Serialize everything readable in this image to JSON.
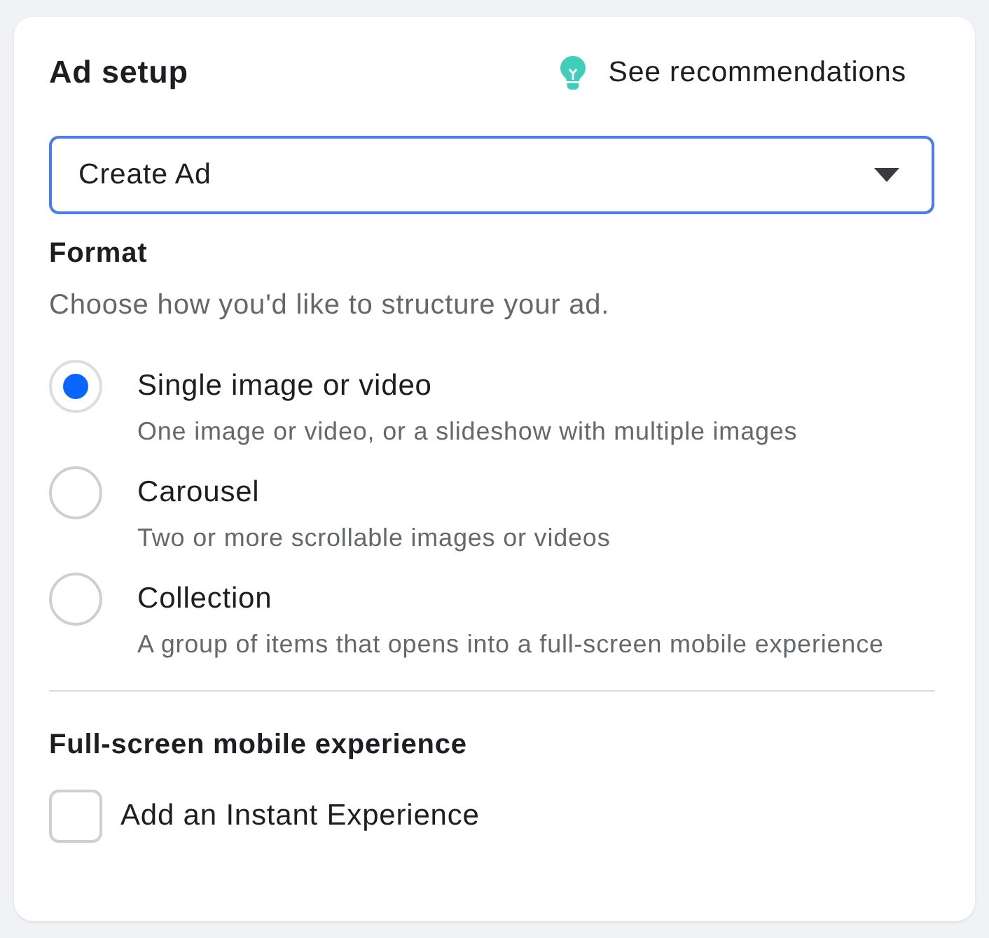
{
  "header": {
    "title": "Ad setup",
    "recommendations_link": "See recommendations"
  },
  "dropdown": {
    "value": "Create Ad"
  },
  "format": {
    "heading": "Format",
    "subtitle": "Choose how you'd like to structure your ad.",
    "options": [
      {
        "label": "Single image or video",
        "description": "One image or video, or a slideshow with multiple images",
        "selected": true
      },
      {
        "label": "Carousel",
        "description": "Two or more scrollable images or videos",
        "selected": false
      },
      {
        "label": "Collection",
        "description": "A group of items that opens into a full-screen mobile experience",
        "selected": false
      }
    ]
  },
  "full_screen": {
    "heading": "Full-screen mobile experience",
    "checkbox": {
      "label": "Add an Instant Experience",
      "checked": false
    }
  }
}
